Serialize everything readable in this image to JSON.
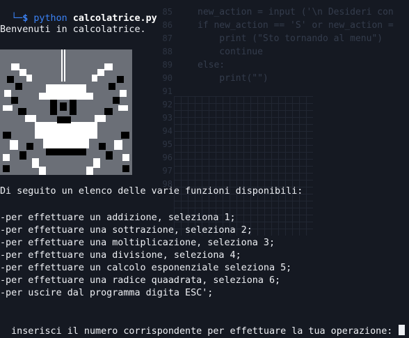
{
  "prompt": {
    "corner": "└─",
    "symbol": "$",
    "command": "python",
    "argument": "calcolatrice.py"
  },
  "welcome": "Benvenuti in calcolatrice.",
  "intro": "Di seguito un elenco delle varie funzioni disponibili:",
  "options": [
    "-per effettuare un addizione, seleziona 1;",
    "-per effettuare una sottrazione, seleziona 2;",
    "-per effettuare una moltiplicazione, seleziona 3;",
    "-per effettuare una divisione, seleziona 4;",
    "-per effettuare un calcolo esponenziale seleziona 5;",
    "-per effettuare una radice quaadrata, seleziona 6;",
    "-per uscire dal programma digita ESC';"
  ],
  "input_prompt": "inserisci il numero corrispondente per effettuare la tua operazione:",
  "background_editor": {
    "code_lines": [
      "new_action = input ('\\n Desideri con",
      "if new_action == 'S' or new_action =",
      "    print (\"Sto tornando al menu\")",
      "    continue",
      "else:",
      "    print(\"\")"
    ],
    "line_numbers": [
      "85",
      "86",
      "87",
      "88",
      "89",
      "90",
      "91",
      "92",
      "93",
      "94",
      "95",
      "96",
      "97",
      "98"
    ]
  },
  "colors": {
    "terminal_bg": "#151922",
    "prompt_blue": "#3b82f6",
    "text": "#eef0f4",
    "art_grey": "#6b6f77"
  }
}
